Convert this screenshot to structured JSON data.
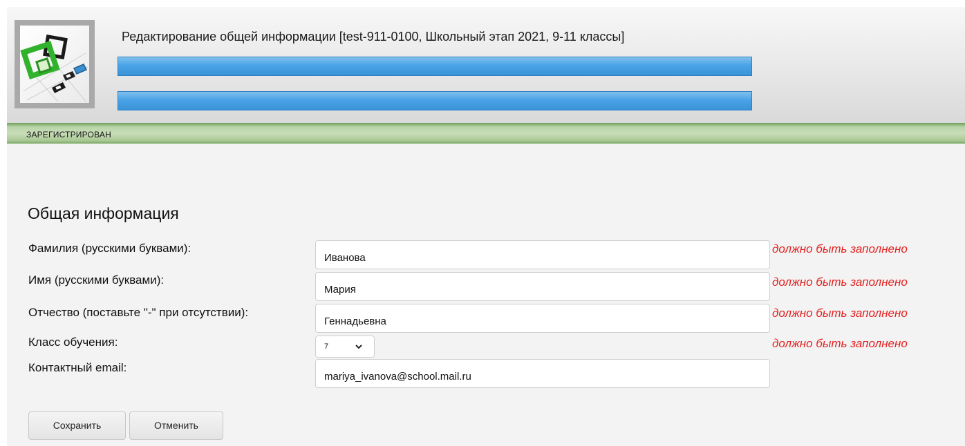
{
  "header": {
    "title": "Редактирование общей информации [test-911-0100, Школьный этап 2021, 9-11 классы]",
    "bar_color": "#4aa3e6"
  },
  "status": {
    "text": "ЗАРЕГИСТРИРОВАН",
    "color": "#b9d4a9"
  },
  "form": {
    "section_title": "Общая информация",
    "fields": [
      {
        "label": "Фамилия (русскими буквами):",
        "value": "Иванова",
        "error": "должно быть заполнено"
      },
      {
        "label": "Имя (русскими буквами):",
        "value": "Мария",
        "error": "должно быть заполнено"
      },
      {
        "label": "Отчество (поставьте \"-\" при отсутствии):",
        "value": "Геннадьевна",
        "error": "должно быть заполнено"
      },
      {
        "label": "Класс обучения:",
        "value": "7",
        "error": "должно быть заполнено"
      },
      {
        "label": "Контактный email:",
        "value": "mariya_ivanova@school.mail.ru"
      }
    ],
    "error_color": "#e32222"
  },
  "buttons": {
    "save": "Сохранить",
    "cancel": "Отменить"
  },
  "icons": {
    "logo": "logo-icon",
    "select_chevron": "chevron-down-icon"
  }
}
